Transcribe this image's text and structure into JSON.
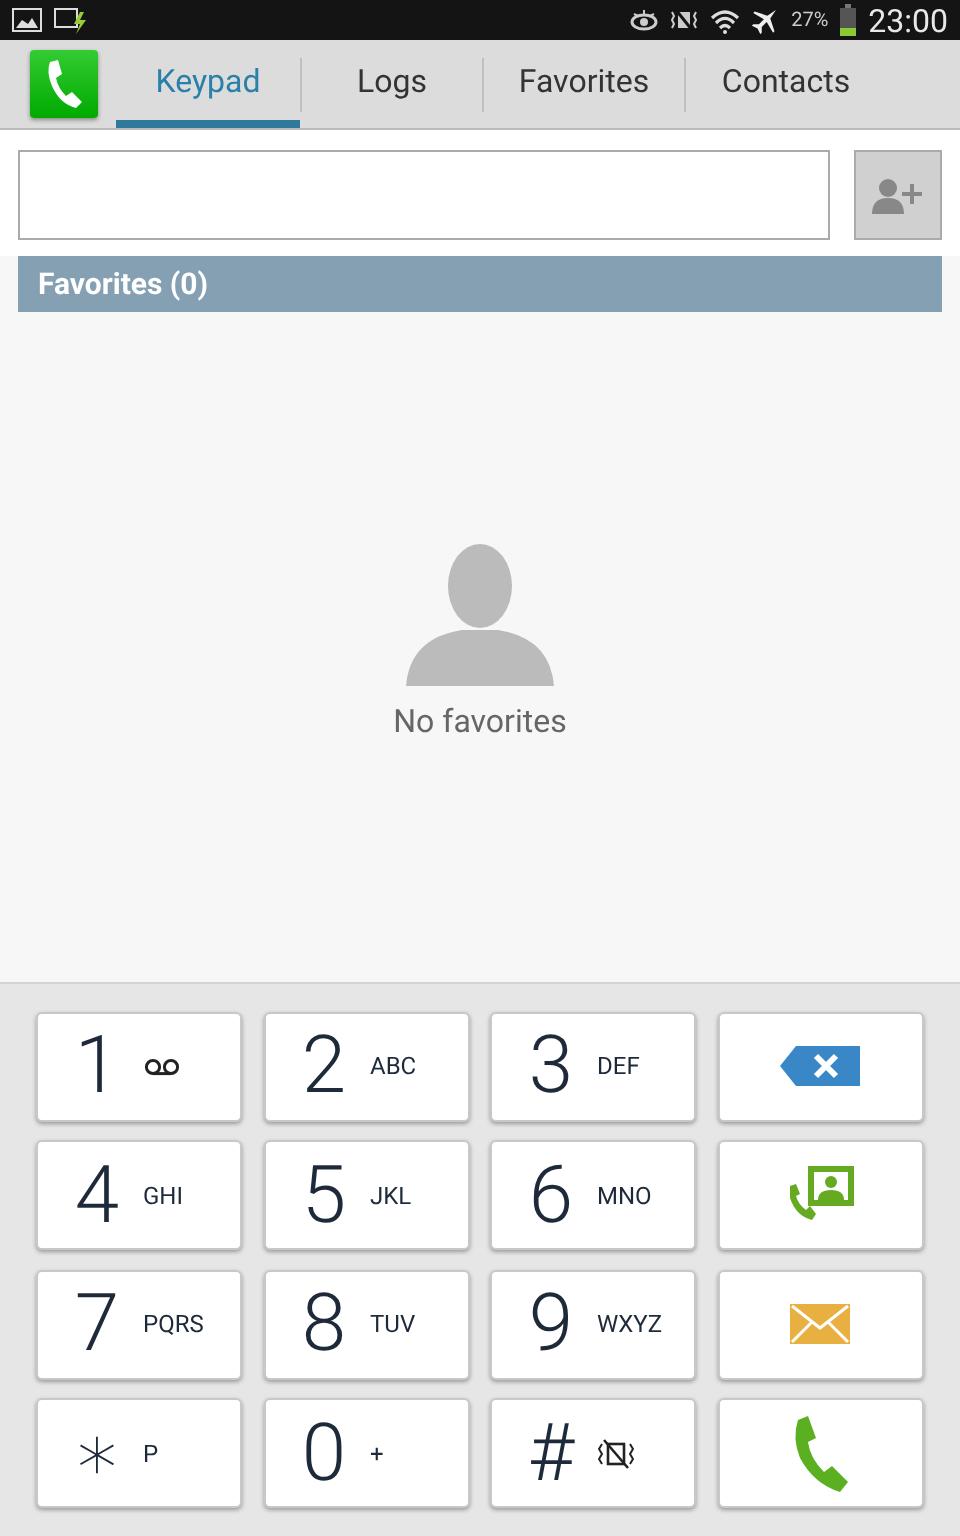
{
  "status_bar": {
    "battery_percent": "27%",
    "time": "23:00"
  },
  "tabs": [
    {
      "label": "Keypad",
      "selected": true
    },
    {
      "label": "Logs",
      "selected": false
    },
    {
      "label": "Favorites",
      "selected": false
    },
    {
      "label": "Contacts",
      "selected": false
    }
  ],
  "favorites": {
    "header": "Favorites (0)",
    "empty_text": "No favorites"
  },
  "keypad": [
    {
      "kind": "voicemail",
      "digit": "1"
    },
    {
      "kind": "digit",
      "digit": "2",
      "letters": "ABC"
    },
    {
      "kind": "digit",
      "digit": "3",
      "letters": "DEF"
    },
    {
      "kind": "delete"
    },
    {
      "kind": "digit",
      "digit": "4",
      "letters": "GHI"
    },
    {
      "kind": "digit",
      "digit": "5",
      "letters": "JKL"
    },
    {
      "kind": "digit",
      "digit": "6",
      "letters": "MNO"
    },
    {
      "kind": "contact"
    },
    {
      "kind": "digit",
      "digit": "7",
      "letters": "PQRS"
    },
    {
      "kind": "digit",
      "digit": "8",
      "letters": "TUV"
    },
    {
      "kind": "digit",
      "digit": "9",
      "letters": "WXYZ"
    },
    {
      "kind": "message"
    },
    {
      "kind": "digit",
      "digit": "∗",
      "letters": "P"
    },
    {
      "kind": "digit",
      "digit": "0",
      "letters": "+"
    },
    {
      "kind": "vibrate",
      "digit": "#"
    },
    {
      "kind": "call"
    }
  ]
}
